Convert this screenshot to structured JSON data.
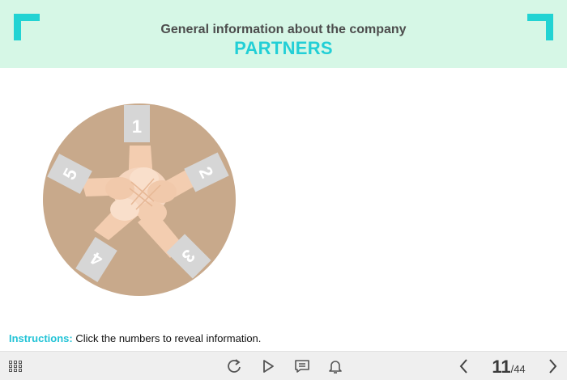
{
  "header": {
    "subtitle": "General information about the company",
    "title": "PARTNERS",
    "accent_color": "#22d3d3",
    "background_color": "#d6f7e6"
  },
  "illustration": {
    "description_icon": "hands-together-circle",
    "numbers": [
      "1",
      "2",
      "3",
      "4",
      "5"
    ]
  },
  "instructions": {
    "label": "Instructions:",
    "text": "Click the numbers to reveal information."
  },
  "toolbar": {
    "icons": [
      "grid-menu-icon",
      "replay-icon",
      "play-icon",
      "notes-icon",
      "bell-icon",
      "prev-icon",
      "next-icon"
    ],
    "current_page": "11",
    "total_pages": "/44"
  }
}
